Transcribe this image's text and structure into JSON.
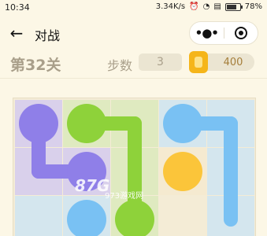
{
  "status_bar": {
    "time": "10:34",
    "speed": "3.34K/s",
    "battery": "78%",
    "battery_level": 0.78
  },
  "nav": {
    "title": "对战",
    "back_icon": "arrow-left-icon",
    "more_icon": "more-dots-icon",
    "close_icon": "target-circle-icon"
  },
  "info": {
    "level": "第32关",
    "steps_label": "步数",
    "steps_value": "3",
    "coins": "400"
  },
  "watermark": {
    "logo": "87G",
    "url": "973游戏网"
  },
  "board": {
    "rows": 3,
    "cols": 5,
    "cell_tints": [
      [
        "#d9d0eb",
        "#dfeac0",
        "#dfeac0",
        "#d4e6ee",
        "#d4e6ee"
      ],
      [
        "#d9d0eb",
        "#d9d0eb",
        "#dfeac0",
        "#f5ead0",
        "#d4e6ee"
      ],
      [
        "#d4e6ee",
        "#d4e6ee",
        "#dfeac0",
        "#f4ecd6",
        "#d4e6ee"
      ]
    ],
    "flows": [
      {
        "color": "purple",
        "hex": "#8f7fe8",
        "endpoints": [
          [
            0,
            0
          ],
          [
            1,
            1
          ]
        ],
        "path": [
          [
            0,
            0
          ],
          [
            1,
            0
          ],
          [
            1,
            1
          ]
        ]
      },
      {
        "color": "green",
        "hex": "#8ed23a",
        "endpoints": [
          [
            0,
            1
          ],
          [
            2,
            2
          ]
        ],
        "path": [
          [
            0,
            1
          ],
          [
            0,
            2
          ],
          [
            1,
            2
          ],
          [
            2,
            2
          ]
        ]
      },
      {
        "color": "blue",
        "hex": "#79c1f3",
        "endpoints": [
          [
            0,
            3
          ],
          [
            2,
            1
          ]
        ],
        "path": [
          [
            0,
            3
          ],
          [
            0,
            4
          ],
          [
            1,
            4
          ],
          [
            2,
            4
          ]
        ]
      },
      {
        "color": "yellow",
        "hex": "#fbc53a",
        "endpoints": [
          [
            1,
            3
          ]
        ],
        "path": [
          [
            1,
            3
          ]
        ]
      }
    ]
  }
}
